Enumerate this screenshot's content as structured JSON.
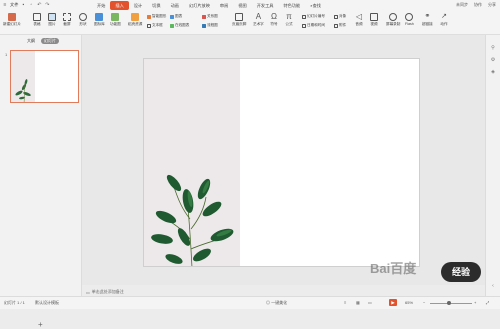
{
  "menubar": {
    "file_label": "文件",
    "tabs": [
      "开始",
      "插入",
      "设计",
      "切换",
      "动画",
      "幻灯片放映",
      "审阅",
      "视图",
      "开发工具",
      "特色功能"
    ],
    "active_tab": "插入",
    "search_label": "查找",
    "right_items": [
      "未同步",
      "协作",
      "分享"
    ]
  },
  "ribbon": {
    "buttons": [
      "新建幻灯片",
      "表格",
      "图片",
      "截屏",
      "形状",
      "图标库",
      "功能图",
      "稻壳资源"
    ],
    "small_items": [
      "智能图形",
      "图表",
      "文本框",
      "在线图表",
      "关系图",
      "流程图",
      "思维导图",
      "页眉页脚",
      "艺术字",
      "符号",
      "公式",
      "幻灯片编号",
      "对象",
      "日期和时间",
      "附件",
      "音频",
      "视频",
      "屏幕录制",
      "Flash",
      "超链接",
      "动作"
    ]
  },
  "left_panel": {
    "tabs": [
      "大纲",
      "幻灯片"
    ],
    "active_tab": "幻灯片",
    "slide_number": "1",
    "add_label": "+"
  },
  "notes": {
    "placeholder": "单击此处添加备注"
  },
  "statusbar": {
    "slide_info": "幻灯片 1 / 1",
    "theme": "默认设计模板",
    "beautify": "一键美化",
    "zoom": "65%"
  },
  "watermark": {
    "text": "Bai百度",
    "badge": "经验"
  }
}
